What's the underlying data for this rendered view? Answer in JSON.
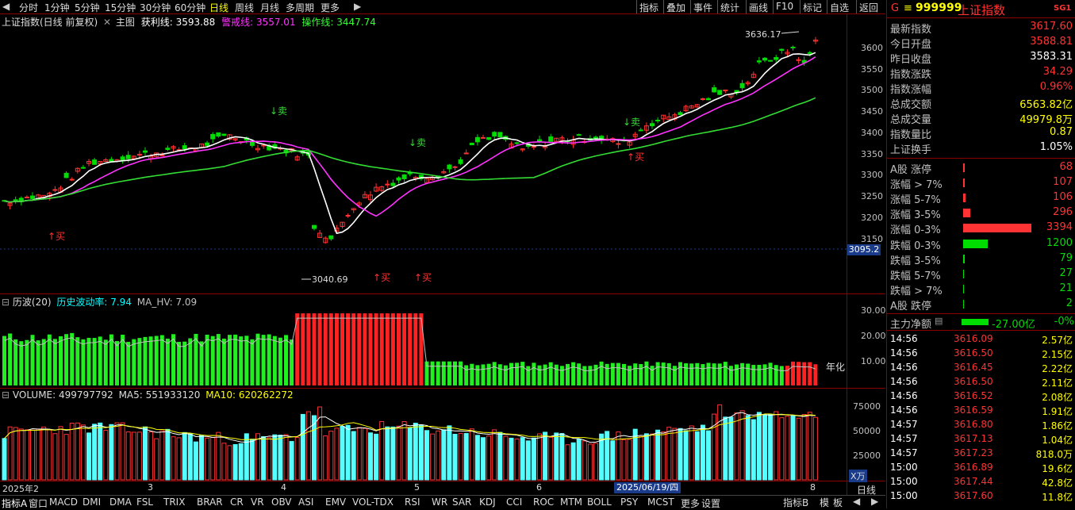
{
  "toolbar": {
    "items": [
      "分时",
      "1分钟",
      "5分钟",
      "15分钟",
      "30分钟",
      "60分钟",
      "日线",
      "周线",
      "月线",
      "多周期",
      "更多"
    ],
    "active": "日线",
    "right": [
      "指标",
      "叠加",
      "事件",
      "统计",
      "画线",
      "F10",
      "标记",
      "自选",
      "返回"
    ],
    "scroll_left": "◀",
    "scroll_right": "▶"
  },
  "chart": {
    "main_title": "上证指数(日线 前复权)",
    "main_label": "主图",
    "profit_line_label": "获利线:",
    "profit_line_value": "3593.88",
    "warn_line_label": "警戒线:",
    "warn_line_value": "3557.01",
    "op_line_label": "操作线:",
    "op_line_value": "3447.74",
    "high_label": "3636.17",
    "low_label": "3040.69",
    "cursor_price": "3095.2",
    "price_ticks": [
      "3600",
      "3550",
      "3500",
      "3450",
      "3400",
      "3350",
      "3300",
      "3250",
      "3200",
      "3150"
    ],
    "signals": {
      "buy": "买",
      "sell": "卖"
    },
    "hv_title": "历波(20)",
    "hv_label": "历史波动率:",
    "hv_value": "7.94",
    "mahv_label": "MA_HV:",
    "mahv_value": "7.09",
    "hv_ticks": [
      "30.00",
      "20.00",
      "10.00"
    ],
    "hv_unit": "年化",
    "vol_label": "VOLUME:",
    "vol_value": "499797792",
    "ma5_label": "MA5:",
    "ma5_value": "551933120",
    "ma10_label": "MA10:",
    "ma10_value": "620262272",
    "vol_ticks": [
      "75000",
      "50000",
      "25000"
    ],
    "vol_unit": "X万",
    "x_labels": [
      "2025年2",
      "3",
      "4",
      "5",
      "6",
      "8"
    ],
    "cursor_date": "2025/06/19/四",
    "bottom_right_label": "日线"
  },
  "bottom_tabs": [
    "指标A",
    "窗口",
    "MACD",
    "DMI",
    "DMA",
    "FSL",
    "TRIX",
    "BRAR",
    "CR",
    "VR",
    "OBV",
    "ASI",
    "EMV",
    "VOL-TDX",
    "RSI",
    "WR",
    "SAR",
    "KDJ",
    "CCI",
    "ROC",
    "MTM",
    "BOLL",
    "PSY",
    "MCST",
    "更多",
    "设置"
  ],
  "bottom_right_tabs": [
    "指标B",
    "模",
    "板"
  ],
  "panel": {
    "header_prefix": "G",
    "code": "999999",
    "name": "上证指数",
    "badge": "SG1",
    "quote": [
      {
        "k": "最新指数",
        "v": "3617.60",
        "c": "red"
      },
      {
        "k": "今日开盘",
        "v": "3588.81",
        "c": "red"
      },
      {
        "k": "昨日收盘",
        "v": "3583.31",
        "c": "white"
      },
      {
        "k": "指数涨跌",
        "v": "34.29",
        "c": "red"
      },
      {
        "k": "指数涨幅",
        "v": "0.96%",
        "c": "red"
      },
      {
        "k": "总成交额",
        "v": "6563.82亿",
        "c": "yellow"
      },
      {
        "k": "总成交量",
        "v": "49979.8万",
        "c": "yellow"
      },
      {
        "k": "指数量比",
        "v": "0.87",
        "c": "yellow"
      },
      {
        "k": "上证换手",
        "v": "1.05%",
        "c": "white"
      }
    ],
    "breadth": [
      {
        "k": "A股 涨停",
        "v": "68",
        "c": "red",
        "bar": 2,
        "bc": "red"
      },
      {
        "k": "涨幅 > 7%",
        "v": "107",
        "c": "red",
        "bar": 2,
        "bc": "red"
      },
      {
        "k": "涨幅 5-7%",
        "v": "106",
        "c": "red",
        "bar": 3,
        "bc": "red"
      },
      {
        "k": "涨幅 3-5%",
        "v": "296",
        "c": "red",
        "bar": 9,
        "bc": "red"
      },
      {
        "k": "涨幅 0-3%",
        "v": "3394",
        "c": "red",
        "bar": 86,
        "bc": "red"
      },
      {
        "k": "跌幅 0-3%",
        "v": "1200",
        "c": "green",
        "bar": 31,
        "bc": "green"
      },
      {
        "k": "跌幅 3-5%",
        "v": "79",
        "c": "green",
        "bar": 2,
        "bc": "green"
      },
      {
        "k": "跌幅 5-7%",
        "v": "27",
        "c": "green",
        "bar": 1,
        "bc": "green"
      },
      {
        "k": "跌幅 > 7%",
        "v": "21",
        "c": "green",
        "bar": 1,
        "bc": "green"
      },
      {
        "k": "A股 跌停",
        "v": "2",
        "c": "green",
        "bar": 1,
        "bc": "green"
      }
    ],
    "fund_label": "主力净额",
    "fund_value": "-27.00亿",
    "fund_pct": "-0%",
    "ticks": [
      {
        "t": "14:56",
        "p": "3616.09",
        "a": "2.57亿"
      },
      {
        "t": "14:56",
        "p": "3616.50",
        "a": "2.15亿"
      },
      {
        "t": "14:56",
        "p": "3616.45",
        "a": "2.22亿"
      },
      {
        "t": "14:56",
        "p": "3616.50",
        "a": "2.11亿"
      },
      {
        "t": "14:56",
        "p": "3616.52",
        "a": "2.08亿"
      },
      {
        "t": "14:56",
        "p": "3616.59",
        "a": "1.91亿"
      },
      {
        "t": "14:57",
        "p": "3616.80",
        "a": "1.86亿"
      },
      {
        "t": "14:57",
        "p": "3617.13",
        "a": "1.04亿"
      },
      {
        "t": "14:57",
        "p": "3617.23",
        "a": "818.0万"
      },
      {
        "t": "15:00",
        "p": "3616.89",
        "a": "19.6亿"
      },
      {
        "t": "15:00",
        "p": "3617.44",
        "a": "42.8亿"
      },
      {
        "t": "15:00",
        "p": "3617.60",
        "a": "11.8亿"
      }
    ]
  }
}
